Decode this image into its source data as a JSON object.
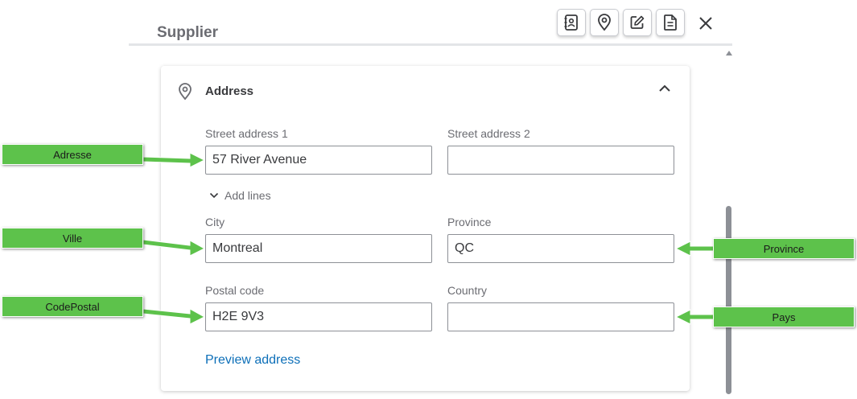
{
  "header": {
    "title": "Supplier",
    "toolbar": [
      {
        "name": "contact-card-icon"
      },
      {
        "name": "location-pin-icon"
      },
      {
        "name": "edit-icon"
      },
      {
        "name": "notes-icon"
      }
    ],
    "close_icon": "close-icon"
  },
  "address_section": {
    "title": "Address",
    "street1": {
      "label": "Street address 1",
      "value": "57 River Avenue"
    },
    "street2": {
      "label": "Street address 2",
      "value": ""
    },
    "add_lines": "Add lines",
    "city": {
      "label": "City",
      "value": "Montreal"
    },
    "province": {
      "label": "Province",
      "value": "QC"
    },
    "postal_code": {
      "label": "Postal code",
      "value": "H2E 9V3"
    },
    "country": {
      "label": "Country",
      "value": ""
    },
    "preview_link": "Preview address"
  },
  "annotations": {
    "adresse": "Adresse",
    "ville": "Ville",
    "code_postal": "CodePostal",
    "province": "Province",
    "pays": "Pays"
  },
  "colors": {
    "callout_fill": "#5dc24b",
    "link": "#0d6fb8",
    "input_border": "#8d9096"
  }
}
